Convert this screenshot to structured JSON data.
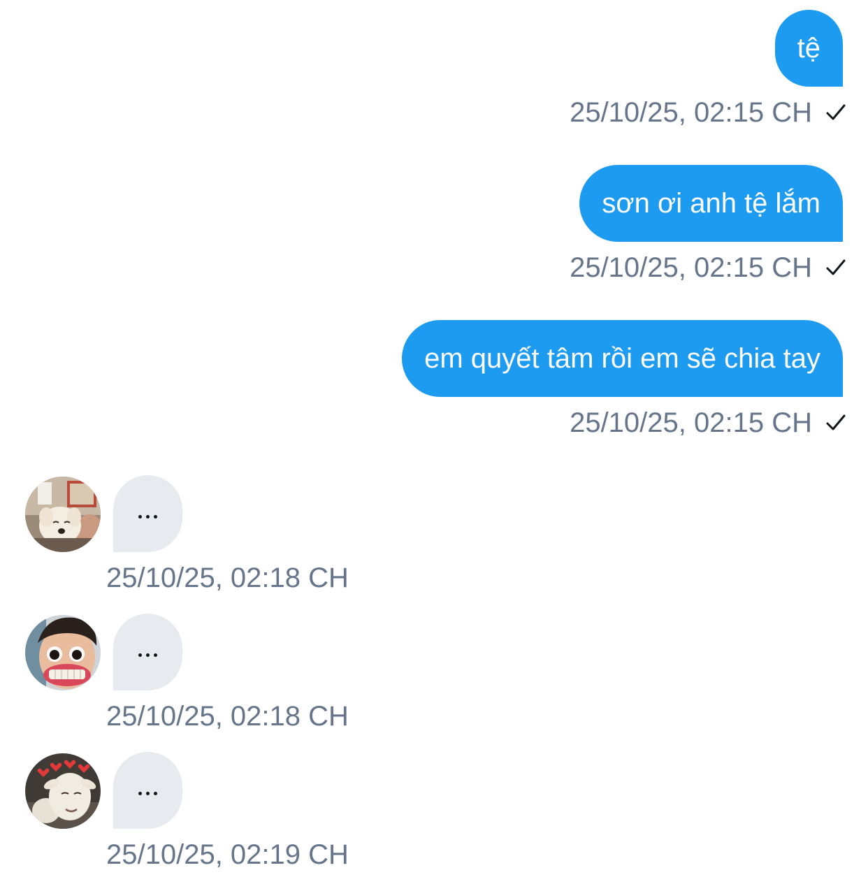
{
  "sent_messages": [
    {
      "text": "tệ",
      "timestamp": "25/10/25, 02:15 CH",
      "status_icon": "check-icon"
    },
    {
      "text": "sơn ơi anh tệ lắm",
      "timestamp": "25/10/25, 02:15 CH",
      "status_icon": "check-icon"
    },
    {
      "text": "em quyết tâm rồi em sẽ chia tay",
      "timestamp": "25/10/25, 02:15 CH",
      "status_icon": "check-icon"
    }
  ],
  "received_messages": [
    {
      "avatar": "avatar-puppy",
      "content": "typing-indicator",
      "timestamp": "25/10/25, 02:18 CH"
    },
    {
      "avatar": "avatar-boy",
      "content": "typing-indicator",
      "timestamp": "25/10/25, 02:18 CH"
    },
    {
      "avatar": "avatar-goat",
      "content": "typing-indicator",
      "timestamp": "25/10/25, 02:19 CH"
    }
  ],
  "colors": {
    "sent_bubble": "#1d9bf0",
    "received_bubble": "#e7ebef",
    "timestamp_text": "#66758a",
    "background": "#ffffff"
  }
}
